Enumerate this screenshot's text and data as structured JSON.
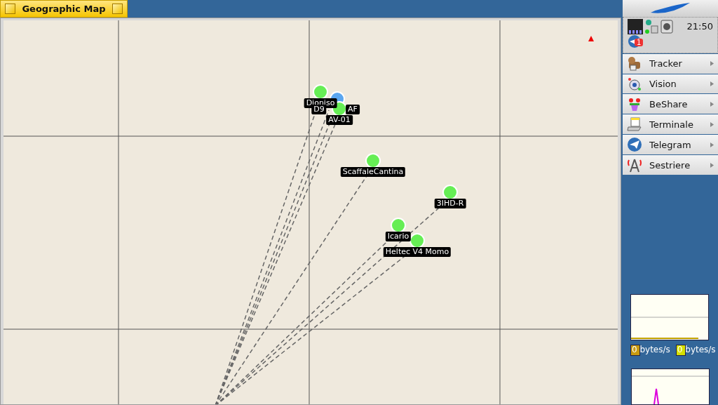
{
  "window": {
    "title": "Geographic Map"
  },
  "map": {
    "nodes": [
      {
        "label": "Dioniso",
        "color": "#66ee55"
      },
      {
        "color": "#5aa6f0"
      },
      {
        "label_parts": [
          "D9",
          "AF"
        ]
      },
      {
        "label": "AV-01",
        "color": "#66ee55"
      },
      {
        "label": "ScaffaleCantina",
        "color": "#66ee55"
      },
      {
        "label": "3IHD-R",
        "color": "#66ee55"
      },
      {
        "label": "Icario",
        "color": "#66ee55"
      },
      {
        "label": "Heltec V4 Momo",
        "color": "#66ee55"
      }
    ]
  },
  "deskbar": {
    "clock": "21:50",
    "mail_badge": "1",
    "items": [
      {
        "label": "Tracker",
        "kind": "dog"
      },
      {
        "label": "Vision",
        "kind": "eye"
      },
      {
        "label": "BeShare",
        "kind": "flower"
      },
      {
        "label": "Terminale",
        "kind": "computer"
      },
      {
        "label": "Telegram",
        "kind": "plane"
      },
      {
        "label": "Sestriere",
        "kind": "antenna"
      }
    ]
  },
  "monitor": {
    "legends": [
      {
        "text": "0 bytes/s",
        "color": "#c89a10"
      },
      {
        "text": "0 bytes/s",
        "color": "#d6e000"
      }
    ]
  }
}
